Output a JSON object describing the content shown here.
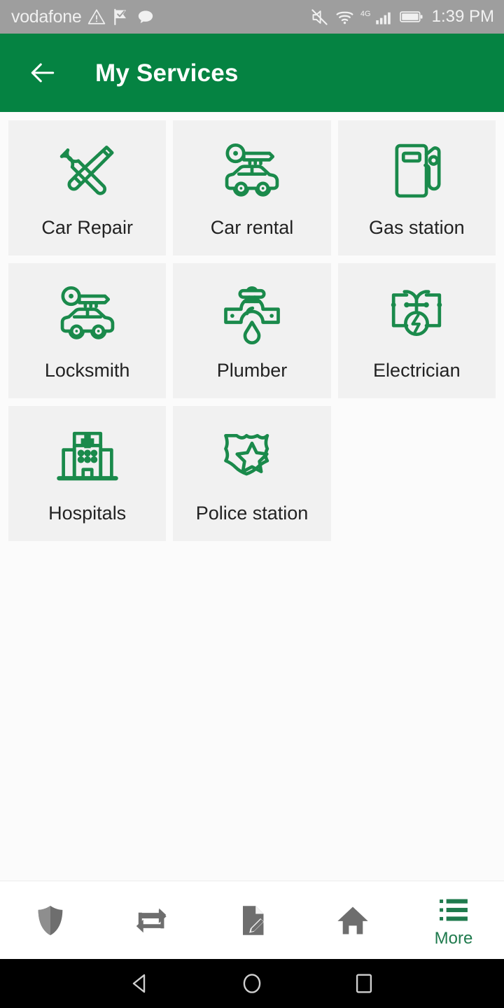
{
  "status_bar": {
    "carrier": "vodafone",
    "time": "1:39 PM",
    "network_type": "4G",
    "icons_left": [
      "warning-triangle-icon",
      "flag-check-icon",
      "speech-bubble-icon"
    ],
    "icons_right": [
      "volume-mute-icon",
      "wifi-icon",
      "signal-bars-icon",
      "battery-icon"
    ],
    "background_color": "#9e9e9e",
    "text_color": "#f2f2f2"
  },
  "app_bar": {
    "title": "My Services",
    "back_icon": "arrow-left-icon",
    "background_color": "#058342",
    "text_color": "#ffffff"
  },
  "theme": {
    "brand_green": "#058342",
    "icon_green": "#1a8a4b",
    "tile_background": "#f1f1f1",
    "page_background": "#fbfbfb",
    "inactive_nav": "#6e6e6e",
    "active_nav": "#1f7a4d"
  },
  "services": [
    {
      "label": "Car Repair",
      "icon": "wrench-screwdriver-icon"
    },
    {
      "label": "Car rental",
      "icon": "key-car-icon"
    },
    {
      "label": "Gas station",
      "icon": "fuel-pump-icon"
    },
    {
      "label": "Locksmith",
      "icon": "key-car-icon"
    },
    {
      "label": "Plumber",
      "icon": "faucet-drop-icon"
    },
    {
      "label": "Electrician",
      "icon": "circuit-bolt-icon"
    },
    {
      "label": "Hospitals",
      "icon": "hospital-building-icon"
    },
    {
      "label": "Police station",
      "icon": "police-badge-icon"
    }
  ],
  "bottom_nav": [
    {
      "label": "",
      "icon": "shield-icon",
      "active": false
    },
    {
      "label": "",
      "icon": "transfer-arrows-icon",
      "active": false
    },
    {
      "label": "",
      "icon": "document-edit-icon",
      "active": false
    },
    {
      "label": "",
      "icon": "home-icon",
      "active": false
    },
    {
      "label": "More",
      "icon": "list-menu-icon",
      "active": true
    }
  ],
  "android_nav": {
    "back": "triangle-back-icon",
    "home": "circle-home-icon",
    "recents": "square-recents-icon"
  }
}
